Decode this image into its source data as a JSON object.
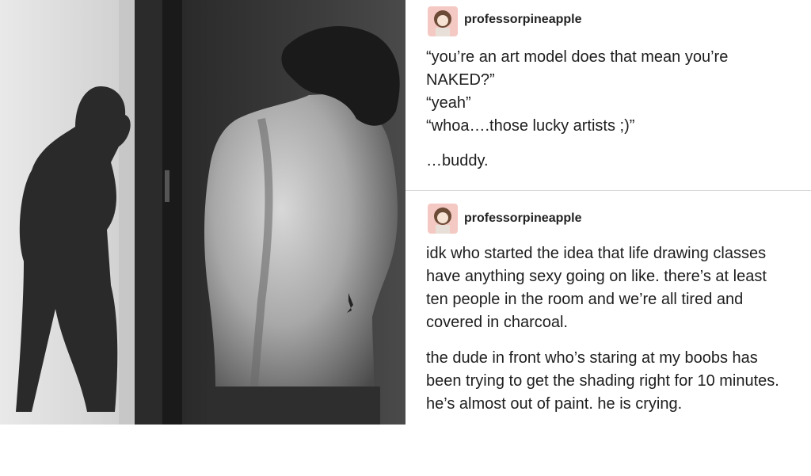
{
  "photo": {
    "description_icon": "photograph-icon"
  },
  "posts": [
    {
      "username": "professorpineapple",
      "lines": [
        "“you’re an art model does that mean you’re",
        "NAKED?”",
        "“yeah”",
        "“whoa….those lucky artists ;)”",
        "…buddy."
      ]
    },
    {
      "username": "professorpineapple",
      "lines": [
        "idk who started the idea that life drawing classes",
        "have anything sexy going on like. there’s at least",
        "ten people in the room and we’re all tired and",
        "covered in charcoal.",
        "the dude in front who’s staring at my boobs has",
        "been trying to get the shading right for 10 minutes.",
        "he’s almost out of paint. he is crying."
      ]
    }
  ]
}
